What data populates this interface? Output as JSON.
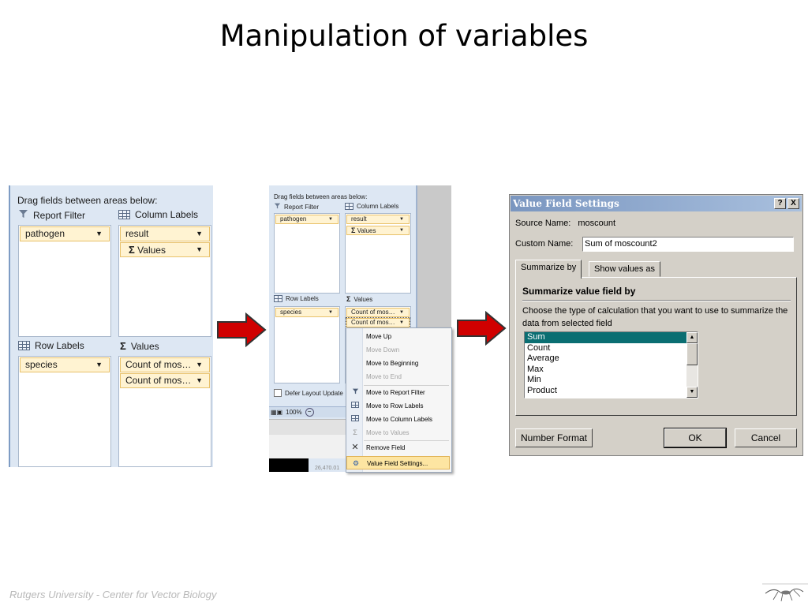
{
  "slide": {
    "title": "Manipulation of variables",
    "footer": "Rutgers University - Center for Vector Biology"
  },
  "panel1": {
    "header": "Drag fields between areas below:",
    "report_filter_label": "Report Filter",
    "column_labels_label": "Column Labels",
    "row_labels_label": "Row Labels",
    "values_label": "Values",
    "report_filter_fields": [
      "pathogen"
    ],
    "column_fields": [
      "result",
      "Values"
    ],
    "row_fields": [
      "species"
    ],
    "value_fields": [
      "Count of mos…",
      "Count of mos…"
    ]
  },
  "panel2": {
    "header": "Drag fields between areas below:",
    "report_filter_label": "Report Filter",
    "column_labels_label": "Column Labels",
    "row_labels_label": "Row Labels",
    "values_label": "Values",
    "report_filter_field": "pathogen",
    "column_fields": [
      "result",
      "Values"
    ],
    "row_field": "species",
    "value_fields": [
      "Count of mos…",
      "Count of mos…"
    ],
    "defer_label": "Defer Layout Update",
    "zoom": "100%",
    "cell_ref": "26,470.01"
  },
  "context_menu": {
    "items": [
      {
        "label": "Move Up",
        "icon": "",
        "disabled": false
      },
      {
        "label": "Move Down",
        "icon": "",
        "disabled": true
      },
      {
        "label": "Move to Beginning",
        "icon": "",
        "disabled": false
      },
      {
        "label": "Move to End",
        "icon": "",
        "disabled": true
      },
      {
        "label": "Move to Report Filter",
        "icon": "filter-icon",
        "disabled": false
      },
      {
        "label": "Move to Row Labels",
        "icon": "row-labels-icon",
        "disabled": false
      },
      {
        "label": "Move to Column Labels",
        "icon": "column-labels-icon",
        "disabled": false
      },
      {
        "label": "Move to Values",
        "icon": "sigma-icon",
        "disabled": true
      },
      {
        "label": "Remove Field",
        "icon": "remove-icon",
        "disabled": false
      },
      {
        "label": "Value Field Settings...",
        "icon": "settings-icon",
        "disabled": false,
        "highlighted": true
      }
    ]
  },
  "dialog": {
    "title": "Value Field Settings",
    "help_btn": "?",
    "close_btn": "X",
    "source_name_label": "Source Name:",
    "source_name_value": "moscount",
    "custom_name_label": "Custom Name:",
    "custom_name_value": "Sum of moscount2",
    "tabs": [
      "Summarize by",
      "Show values as"
    ],
    "group_title": "Summarize value field by",
    "description": "Choose the type of calculation that you want to use to summarize the data from selected field",
    "list_items": [
      "Sum",
      "Count",
      "Average",
      "Max",
      "Min",
      "Product"
    ],
    "selected_item": "Sum",
    "number_format_btn": "Number Format",
    "ok_btn": "OK",
    "cancel_btn": "Cancel"
  },
  "colors": {
    "arrow_fill": "#d00000",
    "panel_bg": "#dde7f3",
    "field_bg": "#fff3d2",
    "selection": "#0a6e72"
  }
}
